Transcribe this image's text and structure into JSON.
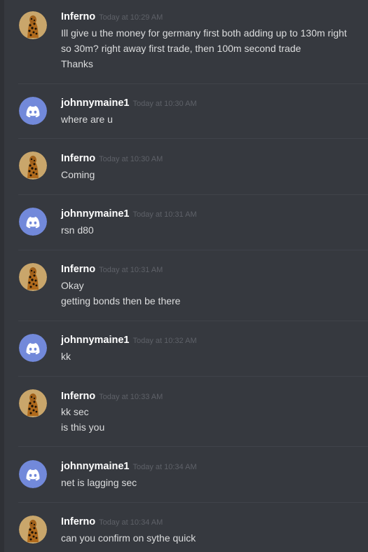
{
  "colors": {
    "background": "#36393f",
    "username": "#ffffff",
    "timestamp": "#5e6168",
    "message_text": "#dcddde",
    "discord_avatar": "#7289da",
    "inferno_avatar_bg": "#c9a66b"
  },
  "messages": [
    {
      "author": "Inferno",
      "avatar": "cheetah-avatar-icon",
      "time": "Today at 10:29 AM",
      "lines": [
        "Ill give u the money for germany first both adding up to 130m right",
        "so 30m? right away first trade, then 100m second trade",
        "Thanks"
      ]
    },
    {
      "author": "johnnymaine1",
      "avatar": "discord-default-avatar-icon",
      "time": "Today at 10:30 AM",
      "lines": [
        "where are u"
      ]
    },
    {
      "author": "Inferno",
      "avatar": "cheetah-avatar-icon",
      "time": "Today at 10:30 AM",
      "lines": [
        "Coming"
      ]
    },
    {
      "author": "johnnymaine1",
      "avatar": "discord-default-avatar-icon",
      "time": "Today at 10:31 AM",
      "lines": [
        "rsn d80"
      ]
    },
    {
      "author": "Inferno",
      "avatar": "cheetah-avatar-icon",
      "time": "Today at 10:31 AM",
      "lines": [
        "Okay",
        "getting bonds then be there"
      ]
    },
    {
      "author": "johnnymaine1",
      "avatar": "discord-default-avatar-icon",
      "time": "Today at 10:32 AM",
      "lines": [
        "kk"
      ]
    },
    {
      "author": "Inferno",
      "avatar": "cheetah-avatar-icon",
      "time": "Today at 10:33 AM",
      "lines": [
        "kk sec",
        "is this you"
      ]
    },
    {
      "author": "johnnymaine1",
      "avatar": "discord-default-avatar-icon",
      "time": "Today at 10:34 AM",
      "lines": [
        "net is lagging sec"
      ]
    },
    {
      "author": "Inferno",
      "avatar": "cheetah-avatar-icon",
      "time": "Today at 10:34 AM",
      "lines": [
        "can you confirm on sythe quick"
      ]
    }
  ]
}
